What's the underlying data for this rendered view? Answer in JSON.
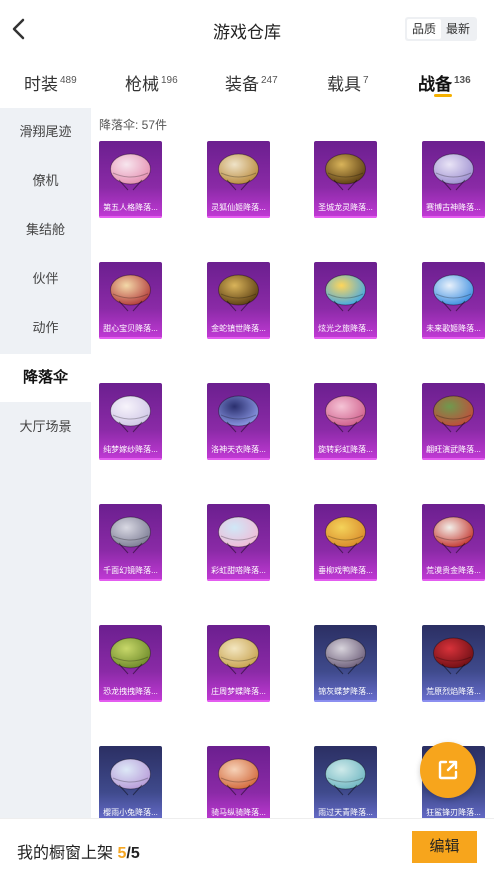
{
  "header": {
    "title": "游戏仓库",
    "back_icon": "chevron-left-icon",
    "sort_options": [
      "品质",
      "最新"
    ],
    "sort_active": 0
  },
  "tabs": [
    {
      "label": "时装",
      "count": "489"
    },
    {
      "label": "枪械",
      "count": "196"
    },
    {
      "label": "装备",
      "count": "247"
    },
    {
      "label": "载具",
      "count": "7"
    },
    {
      "label": "战备",
      "count": "136"
    }
  ],
  "active_tab": 4,
  "colors": {
    "accent": "#f5b000",
    "button": "#f7a51c",
    "card_purple": "#8a2aa6",
    "card_blue": "#3f4a8c",
    "sidebar_bg": "#eef1f5"
  },
  "sidebar": {
    "items": [
      "滑翔尾迹",
      "僚机",
      "集结舱",
      "伙伴",
      "动作",
      "降落伞",
      "大厅场景"
    ],
    "active": 5
  },
  "content": {
    "count_text": "降落伞: 57件",
    "items": [
      {
        "name": "第五人格降落...",
        "art": "pink-white",
        "rarity": "purple"
      },
      {
        "name": "灵狐仙姬降落...",
        "art": "gold-white",
        "rarity": "purple"
      },
      {
        "name": "圣城龙灵降落...",
        "art": "gold-dark",
        "rarity": "purple"
      },
      {
        "name": "赛博古神降落...",
        "art": "lilac",
        "rarity": "purple"
      },
      {
        "name": "甜心宝贝降落...",
        "art": "pattern-red",
        "rarity": "purple"
      },
      {
        "name": "金蛇镇世降落...",
        "art": "gold-dark",
        "rarity": "purple"
      },
      {
        "name": "炫光之旅降落...",
        "art": "colorful",
        "rarity": "purple"
      },
      {
        "name": "未来歌姬降落...",
        "art": "blue-white",
        "rarity": "purple"
      },
      {
        "name": "纯梦嫁纱降落...",
        "art": "white",
        "rarity": "purple"
      },
      {
        "name": "洛神天衣降落...",
        "art": "navy",
        "rarity": "purple"
      },
      {
        "name": "旋转彩虹降落...",
        "art": "pink",
        "rarity": "purple"
      },
      {
        "name": "翩旺演武降落...",
        "art": "green-red",
        "rarity": "purple"
      },
      {
        "name": "千面幻镜降落...",
        "art": "silver",
        "rarity": "purple"
      },
      {
        "name": "彩虹甜嗒降落...",
        "art": "pastel",
        "rarity": "purple"
      },
      {
        "name": "垂柳戏鸭降落...",
        "art": "yellow",
        "rarity": "purple"
      },
      {
        "name": "荒漠贵金降落...",
        "art": "white-red",
        "rarity": "purple"
      },
      {
        "name": "恐龙拽拽降落...",
        "art": "lime",
        "rarity": "purple"
      },
      {
        "name": "庄周梦蝶降落...",
        "art": "cream",
        "rarity": "purple"
      },
      {
        "name": "锦灰蝶梦降落...",
        "art": "gray",
        "rarity": "blue"
      },
      {
        "name": "荒原烈焰降落...",
        "art": "red",
        "rarity": "blue"
      },
      {
        "name": "樱雨小兔降落...",
        "art": "sky",
        "rarity": "blue"
      },
      {
        "name": "骑马纵骑降落...",
        "art": "peach",
        "rarity": "purple"
      },
      {
        "name": "雨过天青降落...",
        "art": "teal",
        "rarity": "blue"
      },
      {
        "name": "狂鲨锋刃降落...",
        "art": "dark",
        "rarity": "blue"
      }
    ]
  },
  "share_icon": "share-external-icon",
  "bottom": {
    "shelf_label": "我的橱窗上架",
    "shelf_current": "5",
    "shelf_total": "/5",
    "edit_label": "编辑"
  }
}
